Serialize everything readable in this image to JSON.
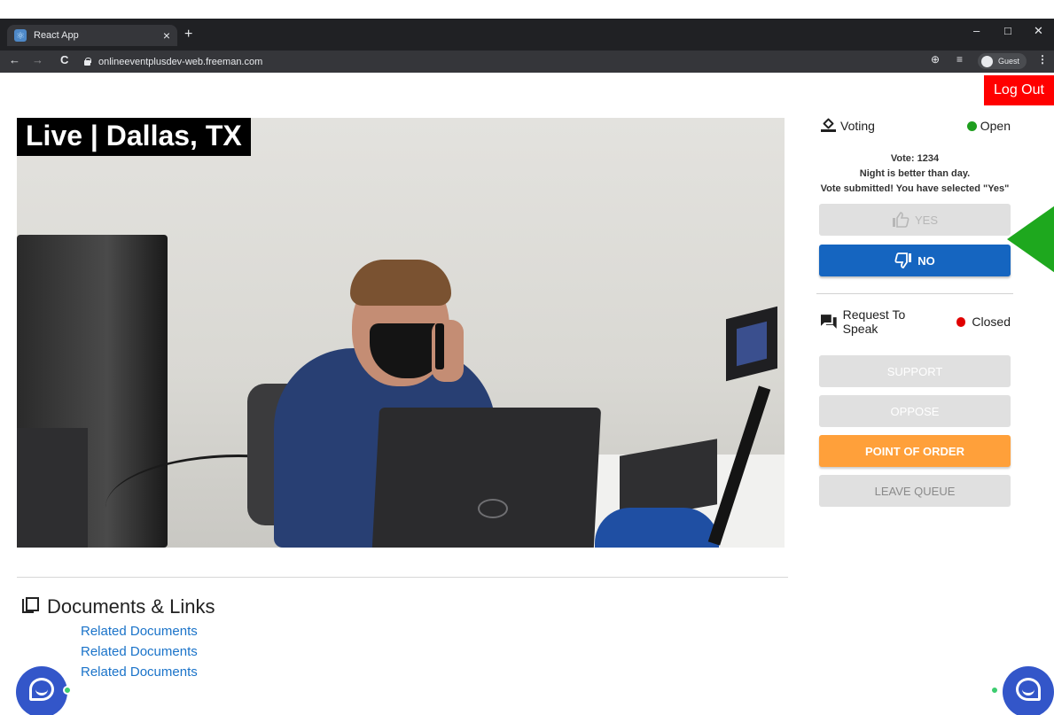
{
  "browser": {
    "tab_title": "React App",
    "tab_close": "×",
    "new_tab": "+",
    "url": "onlineeventplusdev-web.freeman.com",
    "guest_label": "Guest",
    "minimize": "–",
    "maximize": "□",
    "close": "✕",
    "back": "←",
    "forward": "→",
    "reload": "C",
    "zoom": "⊕",
    "reading_list": "≡",
    "menu": "⋮"
  },
  "header": {
    "logout_label": "Log Out"
  },
  "video": {
    "live_label": "Live | Dallas, TX"
  },
  "documents": {
    "title": "Documents & Links",
    "links": [
      "Related Documents",
      "Related Documents",
      "Related Documents"
    ]
  },
  "voting": {
    "label": "Voting",
    "status": "Open",
    "status_color": "#1e9e1e",
    "vote_number": "Vote: 1234",
    "question": "Night is better than day.",
    "submission_message": "Vote submitted! You have selected \"Yes\"",
    "yes_label": "YES",
    "no_label": "NO"
  },
  "request_to_speak": {
    "label": "Request To Speak",
    "status": "Closed",
    "status_color": "#e00000",
    "support_label": "SUPPORT",
    "oppose_label": "OPPOSE",
    "point_of_order_label": "POINT OF ORDER",
    "leave_queue_label": "LEAVE QUEUE"
  },
  "colors": {
    "primary_blue": "#1565c0",
    "orange": "#ffa03a",
    "logout_red": "#ff0000",
    "link_blue": "#1a73c9",
    "chat_blue": "#3356c9"
  }
}
